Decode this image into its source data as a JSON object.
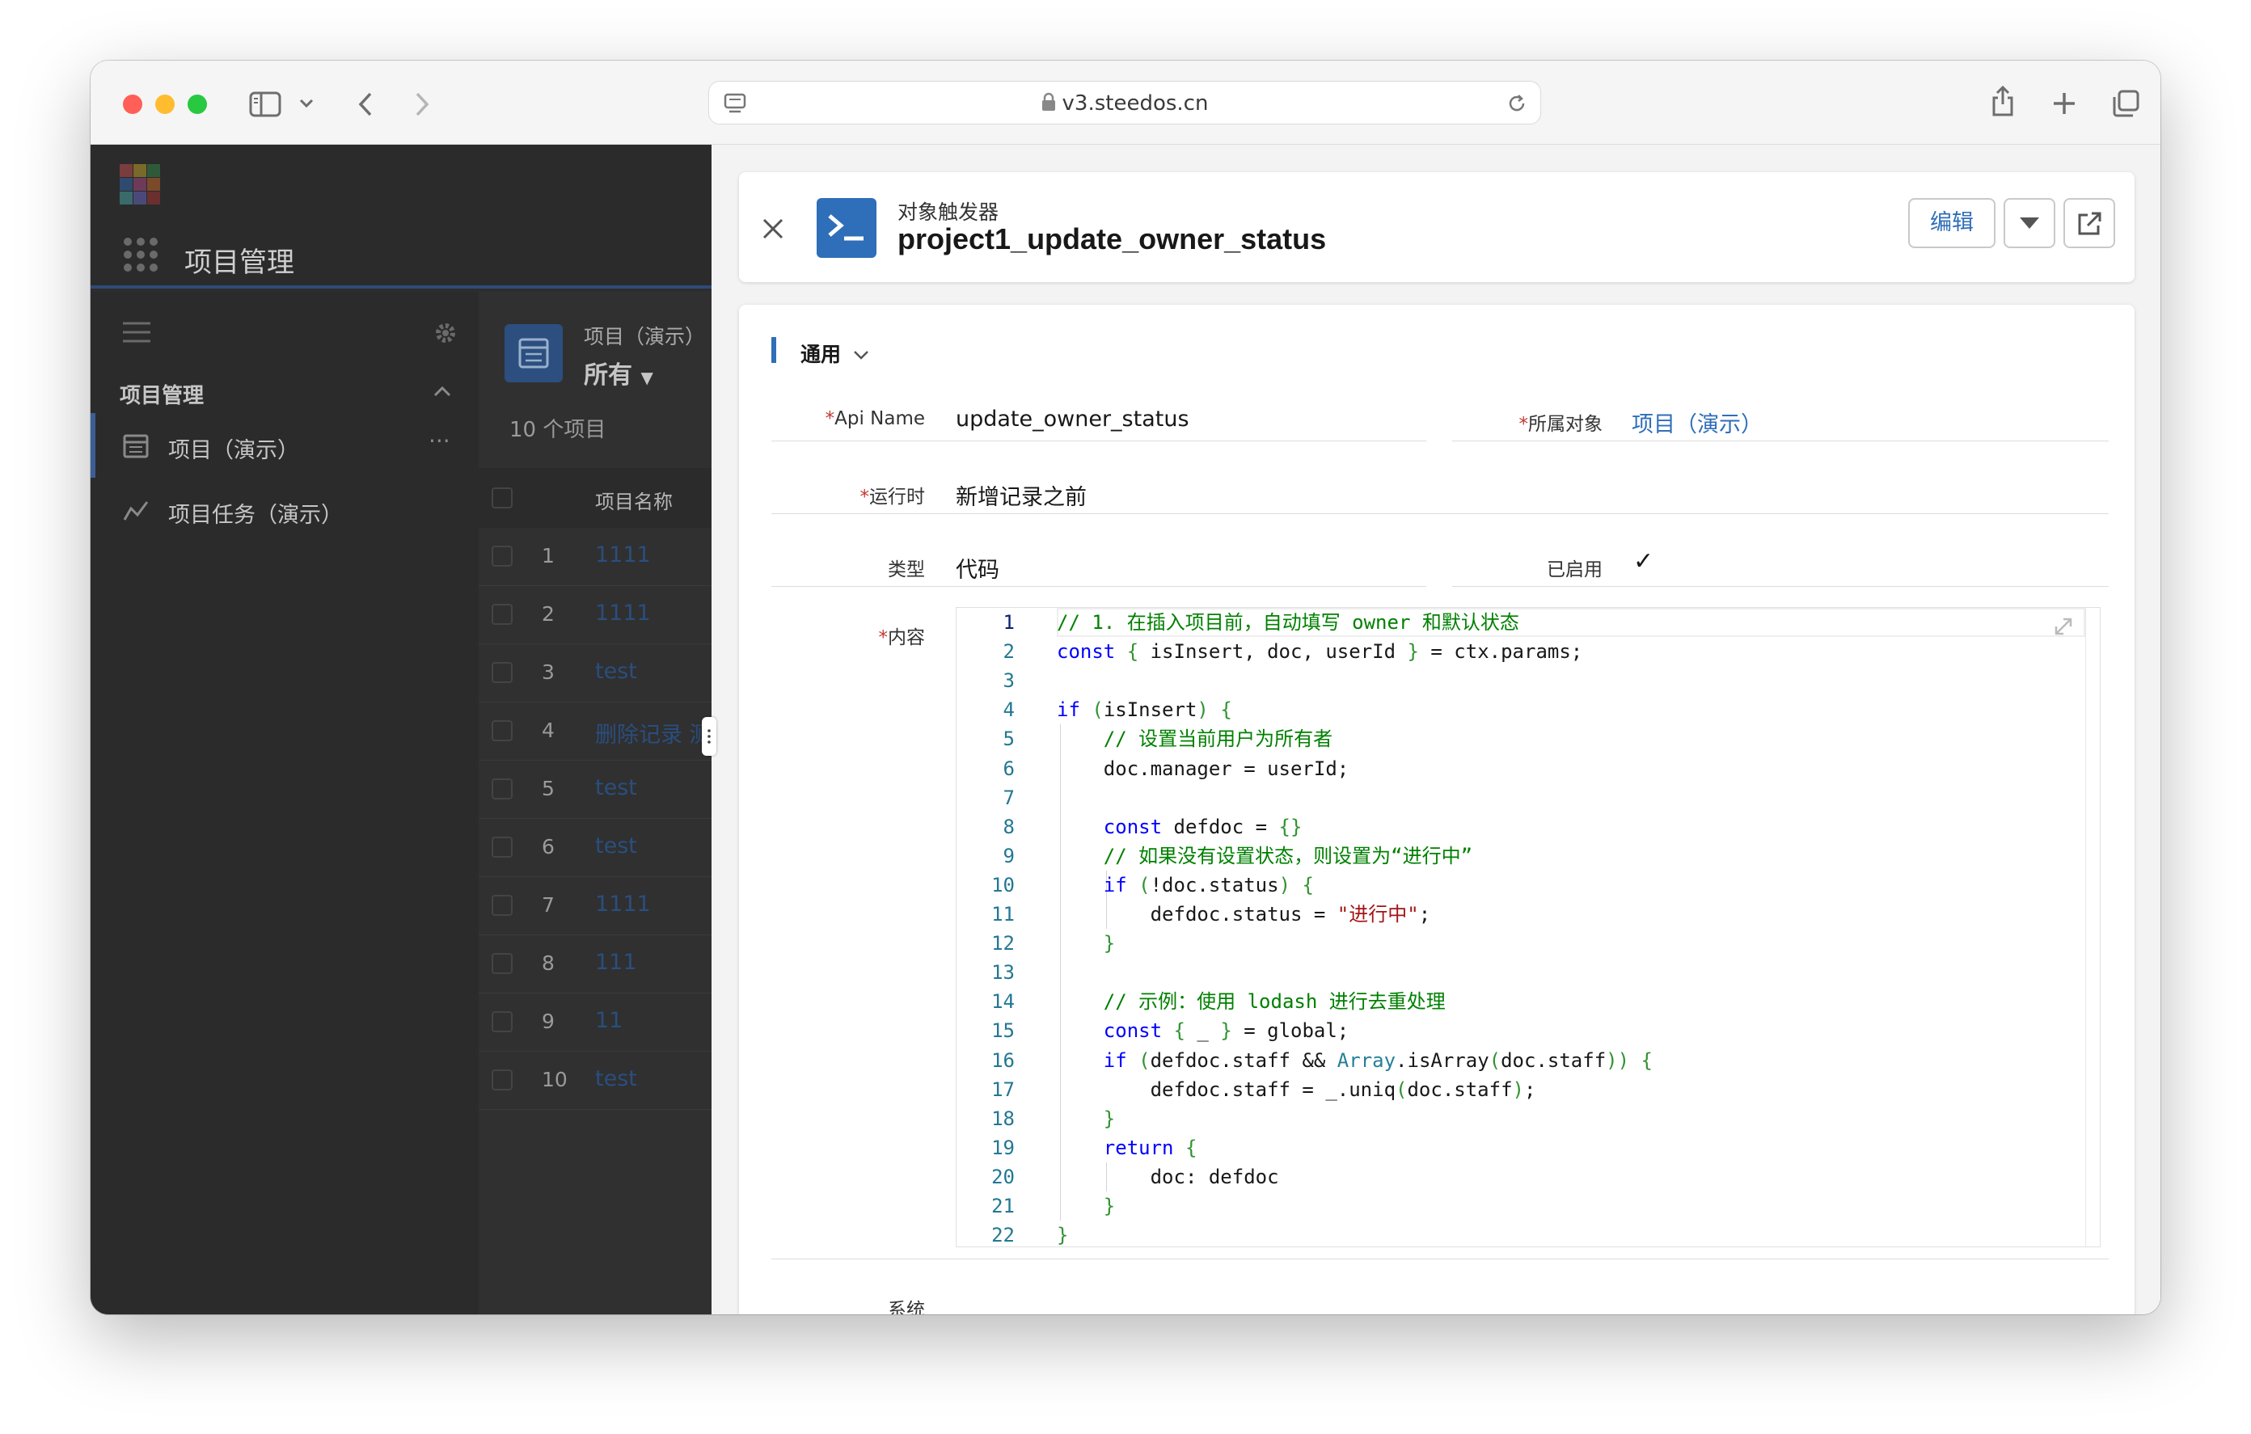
{
  "browser": {
    "url": "v3.steedos.cn",
    "traffic_lights": [
      "#ff5f57",
      "#febc2e",
      "#28c840"
    ]
  },
  "left_app": {
    "app_title": "项目管理",
    "nav_section": "项目管理",
    "nav_items": [
      {
        "label": "项目（演示）",
        "more": "···"
      },
      {
        "label": "项目任务（演示）"
      }
    ],
    "list_object": "项目（演示）",
    "list_view": "所有",
    "list_count": "10 个项目",
    "column_name": "项目名称",
    "rows": [
      {
        "num": "1",
        "name": "1111"
      },
      {
        "num": "2",
        "name": "1111"
      },
      {
        "num": "3",
        "name": "test"
      },
      {
        "num": "4",
        "name": "删除记录 测"
      },
      {
        "num": "5",
        "name": "test"
      },
      {
        "num": "6",
        "name": "test"
      },
      {
        "num": "7",
        "name": "1111"
      },
      {
        "num": "8",
        "name": "111"
      },
      {
        "num": "9",
        "name": "11"
      },
      {
        "num": "10",
        "name": "test"
      }
    ]
  },
  "record": {
    "object_type": "对象触发器",
    "name": "project1_update_owner_status",
    "edit_button": "编辑",
    "section_general": "通用",
    "fields": {
      "api_name_label": "Api Name",
      "api_name_value": "update_owner_status",
      "object_label": "所属对象",
      "object_value": "项目（演示）",
      "when_label": "运行时",
      "when_value": "新增记录之前",
      "type_label": "类型",
      "type_value": "代码",
      "enabled_label": "已启用",
      "enabled_value": "✓",
      "content_label": "内容"
    },
    "section_system": "系统",
    "code_lines": [
      "// 1. 在插入项目前，自动填写 owner 和默认状态",
      "const { isInsert, doc, userId } = ctx.params;",
      "",
      "if (isInsert) {",
      "    // 设置当前用户为所有者",
      "    doc.manager = userId;",
      "",
      "    const defdoc = {}",
      "    // 如果没有设置状态，则设置为“进行中”",
      "    if (!doc.status) {",
      "        defdoc.status = \"进行中\";",
      "    }",
      "",
      "    // 示例：使用 lodash 进行去重处理",
      "    const { _ } = global;",
      "    if (defdoc.staff && Array.isArray(doc.staff)) {",
      "        defdoc.staff = _.uniq(doc.staff);",
      "    }",
      "    return {",
      "        doc: defdoc",
      "    }",
      "}"
    ]
  }
}
